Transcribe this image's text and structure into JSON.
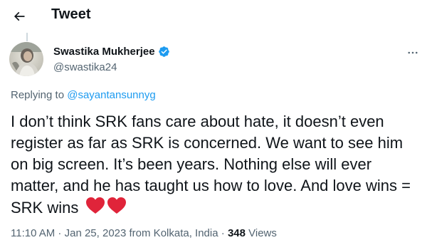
{
  "header": {
    "title": "Tweet",
    "back_icon": "arrow-left-icon"
  },
  "author": {
    "name": "Swastika Mukherjee",
    "handle": "@swastika24",
    "verified_icon": "verified-badge-icon",
    "verified_color": "#1d9bf0"
  },
  "more_icon": "more-horizontal-icon",
  "reply": {
    "prefix": "Replying to ",
    "mention": "@sayantansunnyg"
  },
  "tweet": {
    "text": "I don’t think SRK fans care about hate, it doesn’t even register as far as SRK is concerned. We want to see him on big screen. It’s been years. Nothing else will ever matter, and he has taught us how to love. And love wins = SRK wins",
    "emoji": "❤️❤️",
    "emoji_icon": "red-heart-icon"
  },
  "meta": {
    "time": "11:10 AM",
    "sep1": " · ",
    "date": "Jan 25, 2023 from Kolkata, India",
    "sep2": " · ",
    "views_count": "348",
    "views_label": " Views"
  },
  "colors": {
    "text": "#0f1419",
    "secondary": "#536471",
    "accent": "#1d9bf0",
    "heart": "#e0243a"
  }
}
